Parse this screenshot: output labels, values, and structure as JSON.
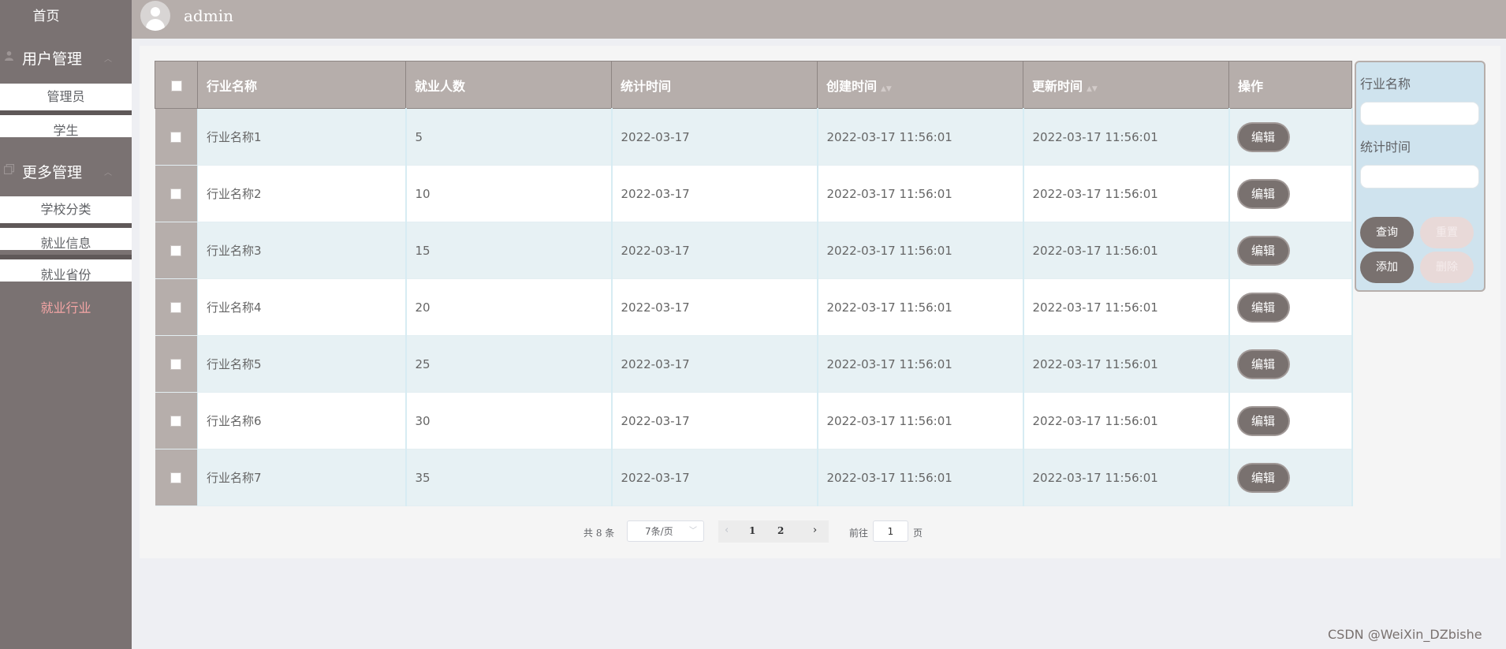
{
  "sidebar": {
    "home": "首页",
    "groups": [
      {
        "label": "用户管理",
        "icon": "user-icon",
        "arrow": "chevron-up-icon",
        "items": [
          {
            "label": "管理员"
          },
          {
            "label": "学生"
          }
        ]
      },
      {
        "label": "更多管理",
        "icon": "copy-icon",
        "arrow": "chevron-up-icon",
        "items": [
          {
            "label": "学校分类"
          },
          {
            "label": "就业信息"
          },
          {
            "label": "就业省份"
          },
          {
            "label": "就业行业",
            "active": true
          }
        ]
      }
    ]
  },
  "topbar": {
    "username": "admin"
  },
  "table": {
    "columns": [
      "行业名称",
      "就业人数",
      "统计时间",
      "创建时间",
      "更新时间",
      "操作"
    ],
    "sortable_columns": [
      "创建时间",
      "更新时间"
    ],
    "rows": [
      {
        "name": "行业名称1",
        "count": "5",
        "stat_date": "2022-03-17",
        "created": "2022-03-17 11:56:01",
        "updated": "2022-03-17 11:56:01"
      },
      {
        "name": "行业名称2",
        "count": "10",
        "stat_date": "2022-03-17",
        "created": "2022-03-17 11:56:01",
        "updated": "2022-03-17 11:56:01"
      },
      {
        "name": "行业名称3",
        "count": "15",
        "stat_date": "2022-03-17",
        "created": "2022-03-17 11:56:01",
        "updated": "2022-03-17 11:56:01"
      },
      {
        "name": "行业名称4",
        "count": "20",
        "stat_date": "2022-03-17",
        "created": "2022-03-17 11:56:01",
        "updated": "2022-03-17 11:56:01"
      },
      {
        "name": "行业名称5",
        "count": "25",
        "stat_date": "2022-03-17",
        "created": "2022-03-17 11:56:01",
        "updated": "2022-03-17 11:56:01"
      },
      {
        "name": "行业名称6",
        "count": "30",
        "stat_date": "2022-03-17",
        "created": "2022-03-17 11:56:01",
        "updated": "2022-03-17 11:56:01"
      },
      {
        "name": "行业名称7",
        "count": "35",
        "stat_date": "2022-03-17",
        "created": "2022-03-17 11:56:01",
        "updated": "2022-03-17 11:56:01"
      }
    ],
    "edit_label": "编辑"
  },
  "pagination": {
    "total_text": "共 8 条",
    "page_size": "7条/页",
    "pages": [
      "1",
      "2"
    ],
    "current_page": "1",
    "goto_prefix": "前往",
    "goto_value": "1",
    "goto_suffix": "页"
  },
  "search": {
    "name_label": "行业名称",
    "name_value": "",
    "date_label": "统计时间",
    "date_value": "",
    "query_label": "查询",
    "reset_label": "重置",
    "add_label": "添加",
    "delete_label": "删除"
  },
  "watermark": "CSDN @WeiXin_DZbishe",
  "colors": {
    "sidebar_bg": "#7a7272",
    "topbar_bg": "#b6aeab",
    "header_bg": "#b6aeab",
    "row_alt_bg": "#e7f1f4",
    "button_bg": "#79716f",
    "active_menu": "#f4a5a5"
  }
}
